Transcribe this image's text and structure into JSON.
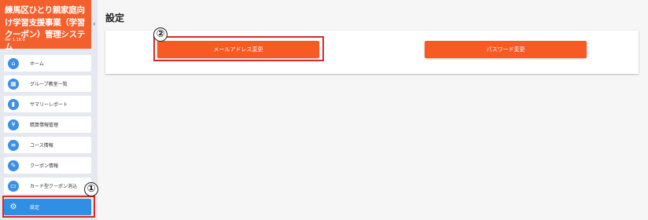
{
  "sidebar": {
    "app_title": "練馬区ひとり親家庭向け学習支援事業（学習クーポン）管理システム",
    "version": "Ver 1.18.0",
    "items": [
      {
        "label": "ホーム",
        "icon": "home-icon"
      },
      {
        "label": "グループ教室一覧",
        "icon": "building-icon"
      },
      {
        "label": "サマリーレポート",
        "icon": "bar-chart-icon"
      },
      {
        "label": "精算情報管理",
        "icon": "money-icon"
      },
      {
        "label": "コース情報",
        "icon": "list-icon"
      },
      {
        "label": "クーポン情報",
        "icon": "ticket-icon"
      },
      {
        "label": "カード型クーポン消込",
        "icon": "card-icon"
      },
      {
        "label": "設定",
        "icon": "gear-icon"
      }
    ]
  },
  "main": {
    "title": "設定",
    "email_button": "メールアドレス変更",
    "password_button": "パスワード変更"
  },
  "annotations": {
    "step1": "①",
    "step2": "②"
  },
  "colors": {
    "brand": "#f4602d",
    "button": "#f85a24",
    "active_nav": "#2f8ee5",
    "annotation": "#d42a2a"
  }
}
